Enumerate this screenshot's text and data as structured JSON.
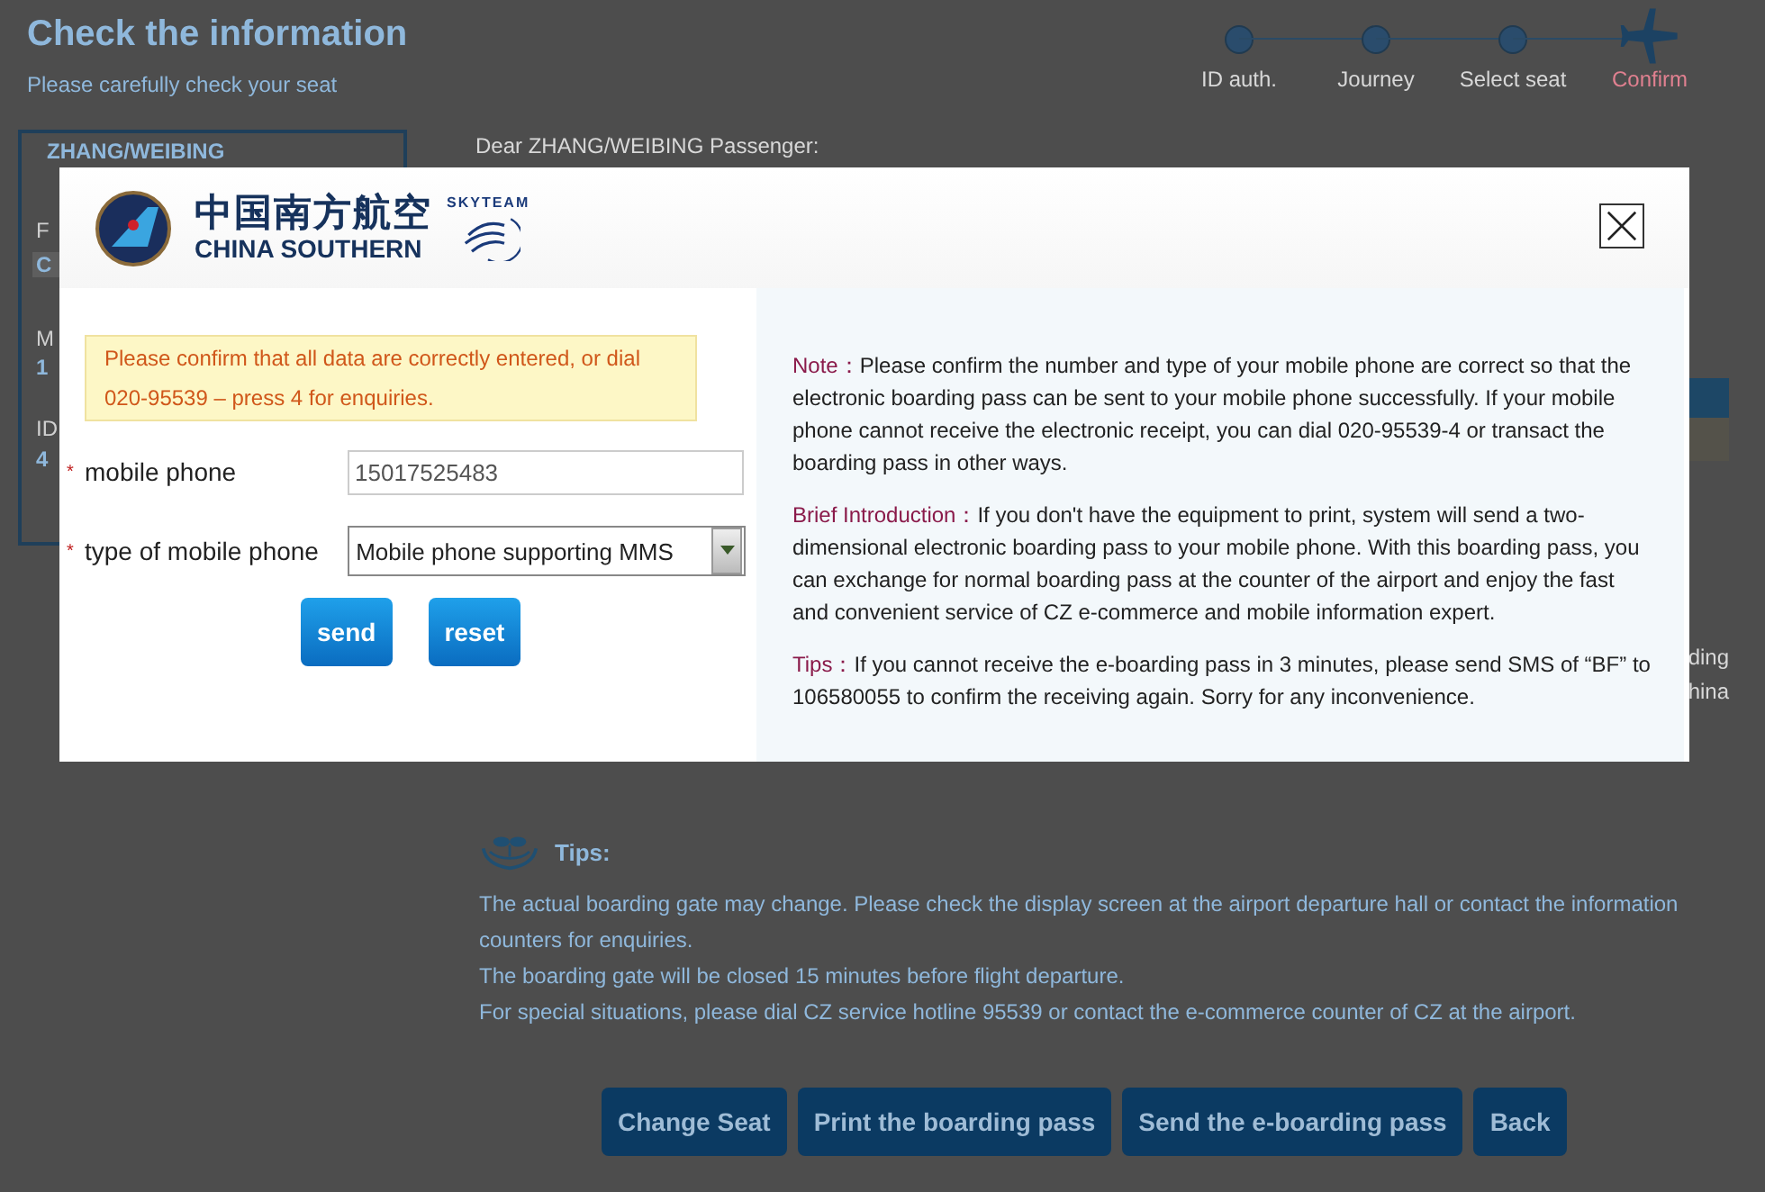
{
  "page": {
    "title": "Check the information",
    "subtitle": "Please carefully check your seat",
    "steps": [
      {
        "label": "ID auth.",
        "selected": false
      },
      {
        "label": "Journey",
        "selected": false
      },
      {
        "label": "Select seat",
        "selected": false
      },
      {
        "label": "Confirm",
        "selected": true
      }
    ],
    "passenger_card": {
      "name": "ZHANG/WEIBING",
      "fragments": [
        "F",
        "C",
        "M",
        "1",
        "ID",
        "4"
      ]
    },
    "greeting": "Dear ZHANG/WEIBING Passenger:",
    "right_fragments": [
      "ding",
      "hina"
    ],
    "tips": {
      "title": "Tips:",
      "lines": [
        "The actual boarding gate may change. Please check the display screen at the airport departure hall or contact the information counters for enquiries.",
        "The boarding gate will be closed 15 minutes before flight departure.",
        "For special situations, please dial CZ service hotline 95539 or contact the e-commerce counter of CZ at the airport."
      ]
    },
    "buttons": [
      "Change Seat",
      "Print the boarding pass",
      "Send the e-boarding pass",
      "Back"
    ]
  },
  "dialog": {
    "logo_chinese": "中国南方航空",
    "logo_english": "CHINA SOUTHERN",
    "alliance": "SKYTEAM",
    "warning": "Please confirm that all data are correctly entered, or dial 020-95539 – press 4 for enquiries.",
    "fields": [
      {
        "kind": "text",
        "mark": "*",
        "label": "mobile phone",
        "value": "15017525483"
      },
      {
        "kind": "select",
        "mark": "*",
        "label": "type of mobile phone",
        "value": "Mobile phone supporting MMS"
      }
    ],
    "buttons": [
      "send",
      "reset"
    ],
    "notes": [
      {
        "label": "Note：",
        "text": "Please confirm the number and type of your mobile phone are correct so that the electronic boarding pass can be sent to your mobile phone successfully. If your mobile phone cannot receive the electronic receipt, you can dial 020-95539-4 or transact the boarding pass in other ways."
      },
      {
        "label": "Brief Introduction：",
        "text": "If you don't have the equipment to print, system will send a two-dimensional electronic boarding pass to your mobile phone. With this boarding pass, you can exchange for normal boarding pass at the counter of the airport and enjoy the fast and convenient service of CZ e-commerce and mobile information expert."
      },
      {
        "label": "Tips：",
        "text": "If you cannot receive the e-boarding pass in 3 minutes, please send SMS of “BF” to 106580055 to confirm the receiving again. Sorry for any inconvenience."
      }
    ]
  }
}
